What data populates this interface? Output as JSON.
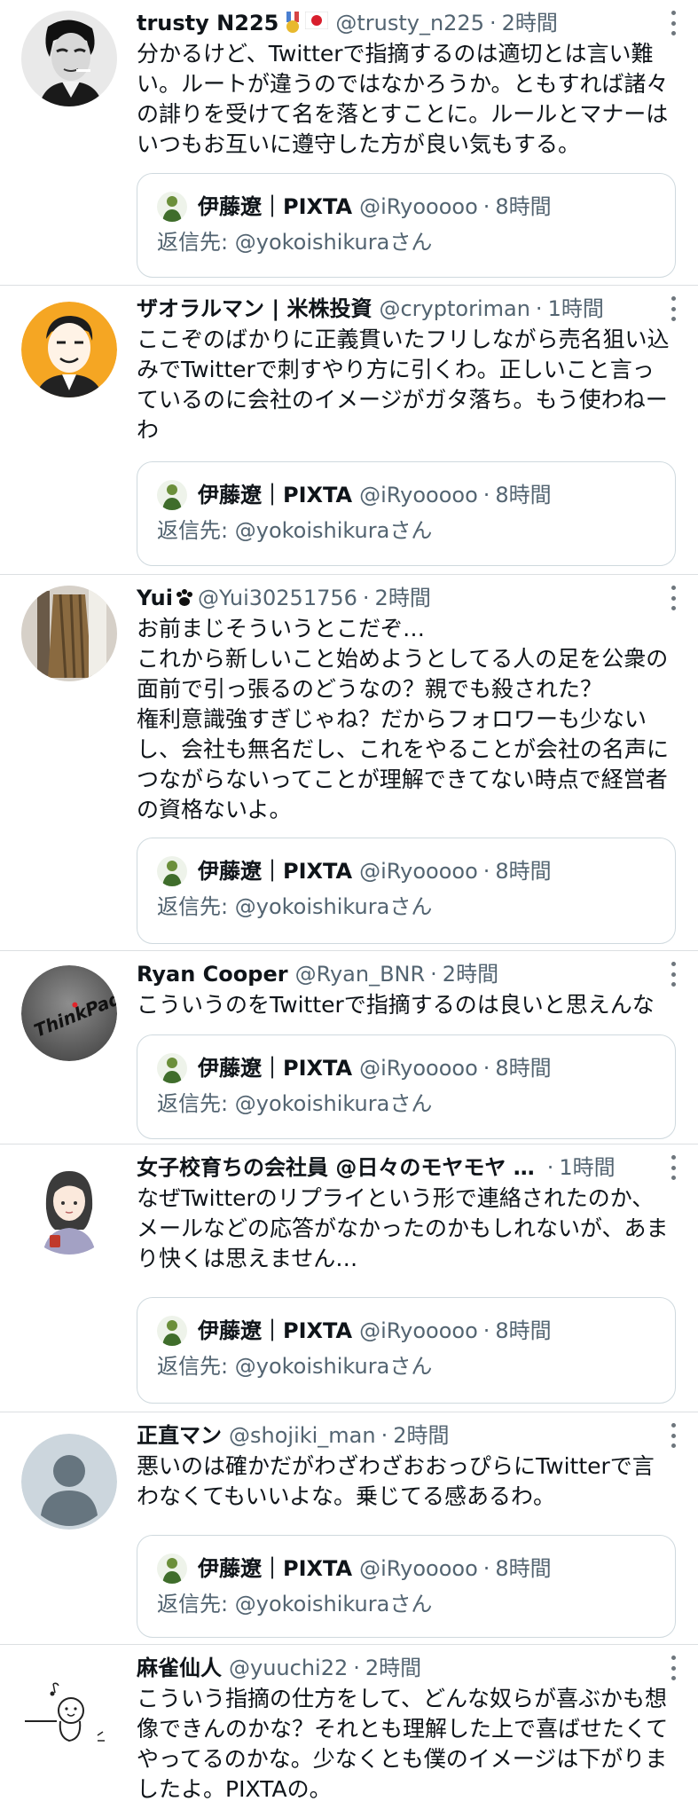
{
  "tweets": [
    {
      "name": "trusty N225",
      "handle": "@trusty_n225",
      "time": "2時間",
      "text": "分かるけど、Twitterで指摘するのは適切とは言い難い。ルートが違うのではなかろうか。ともすれば諸々の誹りを受けて名を落とすことに。ルールとマナーはいつもお互いに遵守した方が良い気もする。",
      "avatar_icon": "man-smoking-avatar"
    },
    {
      "name": "ザオラルマン | 米株投資",
      "handle": "@cryptoriman",
      "time": "1時間",
      "text": "ここぞのばかりに正義貫いたフリしながら売名狙い込みでTwitterで刺すやり方に引くわ。正しいこと言っているのに会社のイメージがガタ落ち。もう使わねーわ",
      "avatar_icon": "cartoon-man-avatar"
    },
    {
      "name": "Yui",
      "handle": "@Yui30251756",
      "time": "2時間",
      "text": "お前まじそういうとこだぞ…\nこれから新しいこと始めようとしてる人の足を公衆の面前で引っ張るのどうなの？親でも殺された？\n権利意識強すぎじゃね？だからフォロワーも少ないし、会社も無名だし、これをやることが会社の名声につながらないってことが理解できてない時点で経営者の資格ないよ。",
      "avatar_icon": "clothes-photo-avatar"
    },
    {
      "name": "Ryan Cooper",
      "handle": "@Ryan_BNR",
      "time": "2時間",
      "text": "こういうのをTwitterで指摘するのは良いと思えんな",
      "avatar_icon": "thinkpad-logo-avatar",
      "avatar_text": "ThinkPad"
    },
    {
      "name": "女子校育ちの会社員 @日々のモヤモヤ …",
      "handle": "",
      "time": "1時間",
      "text": "なぜTwitterのリプライという形で連絡されたのか、メールなどの応答がなかったのかもしれないが、あまり快くは思えません…",
      "avatar_icon": "illustrated-woman-avatar"
    },
    {
      "name": "正直マン",
      "handle": "@shojiki_man",
      "time": "2時間",
      "text": "悪いのは確かだがわざわざおおっぴらにTwitterで言わなくてもいいよな。乗じてる感あるわ。",
      "avatar_icon": "default-person-avatar"
    },
    {
      "name": "麻雀仙人",
      "handle": "@yuuchi22",
      "time": "2時間",
      "text": "こういう指摘の仕方をして、どんな奴らが喜ぶかも想像できんのかな？それとも理解した上で喜ばせたくてやってるのかな。少なくとも僕のイメージは下がりましたよ。PIXTAの。",
      "avatar_icon": "doodle-character-avatar"
    }
  ],
  "quoted": {
    "name": "伊藤遼｜PIXTA",
    "handle": "@iRyooooo",
    "time": "8時間",
    "reply_prefix": "返信先:",
    "reply_to": "@yokoishikura",
    "reply_suffix": "さん"
  },
  "dot": "·",
  "colors": {
    "text": "#0f1419",
    "secondary": "#536471",
    "border": "#cfd9de",
    "divider": "#dcdfe2"
  }
}
